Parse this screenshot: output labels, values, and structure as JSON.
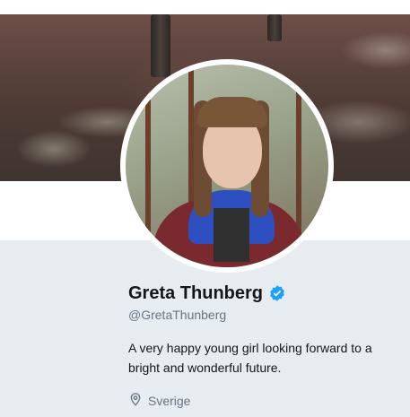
{
  "profile": {
    "name": "Greta Thunberg",
    "handle": "@GretaThunberg",
    "bio": "A very happy young girl looking forward to a bright and wonderful future.",
    "location": "Sverige",
    "verified": true
  },
  "icons": {
    "verified": "verified-badge-icon",
    "location": "location-pin-icon"
  },
  "colors": {
    "accent": "#1da1f2",
    "text_primary": "#14171a",
    "text_secondary": "#657786",
    "background": "#e6ecf0"
  }
}
